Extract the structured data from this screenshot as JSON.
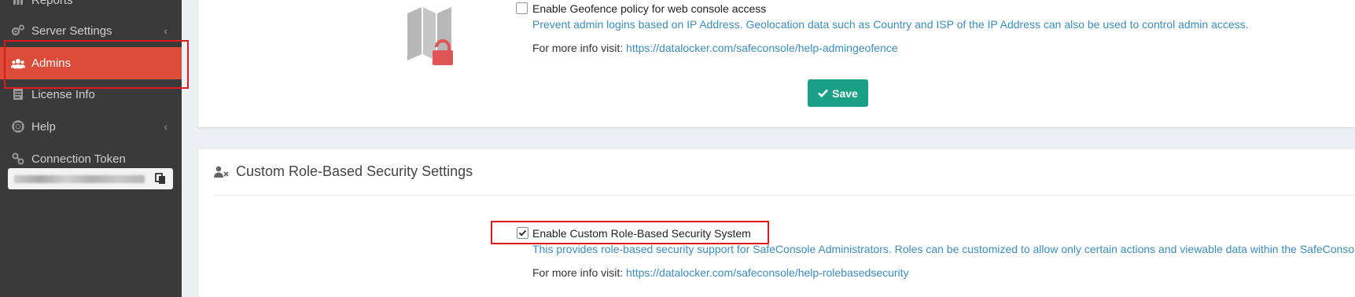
{
  "sidebar": {
    "items": [
      {
        "label": "Reports",
        "icon": "reports-icon"
      },
      {
        "label": "Server Settings",
        "icon": "gears-icon",
        "chevron": "‹"
      },
      {
        "label": "Admins",
        "icon": "users-icon",
        "active": true
      },
      {
        "label": "License Info",
        "icon": "document-icon"
      },
      {
        "label": "Help",
        "icon": "lifebuoy-icon",
        "chevron": "‹"
      },
      {
        "label": "Connection Token",
        "icon": "link-icon"
      }
    ],
    "active_color": "#dd4b39"
  },
  "geofence": {
    "checkbox_label": "Enable Geofence policy for web console access",
    "checked": false,
    "description": "Prevent admin logins based on IP Address. Geolocation data such as Country and ISP of the IP Address can also be used to control admin access.",
    "more_info_prefix": "For more info visit:",
    "more_info_link": "https://datalocker.com/safeconsole/help-admingeofence",
    "save_label": "Save",
    "image_icon": "map-lock-icon"
  },
  "rbac": {
    "section_title": "Custom Role-Based Security Settings",
    "section_icon": "user-times-icon",
    "checkbox_label": "Enable Custom Role-Based Security System",
    "checked": true,
    "description": "This provides role-based security support for SafeConsole Administrators. Roles can be customized to allow only certain actions and viewable data within the SafeConsole.",
    "more_info_prefix": "For more info visit:",
    "more_info_link": "https://datalocker.com/safeconsole/help-rolebasedsecurity"
  },
  "colors": {
    "accent_link": "#3c8dbc",
    "save_button": "#1aa087",
    "highlight": "#e0191f"
  }
}
